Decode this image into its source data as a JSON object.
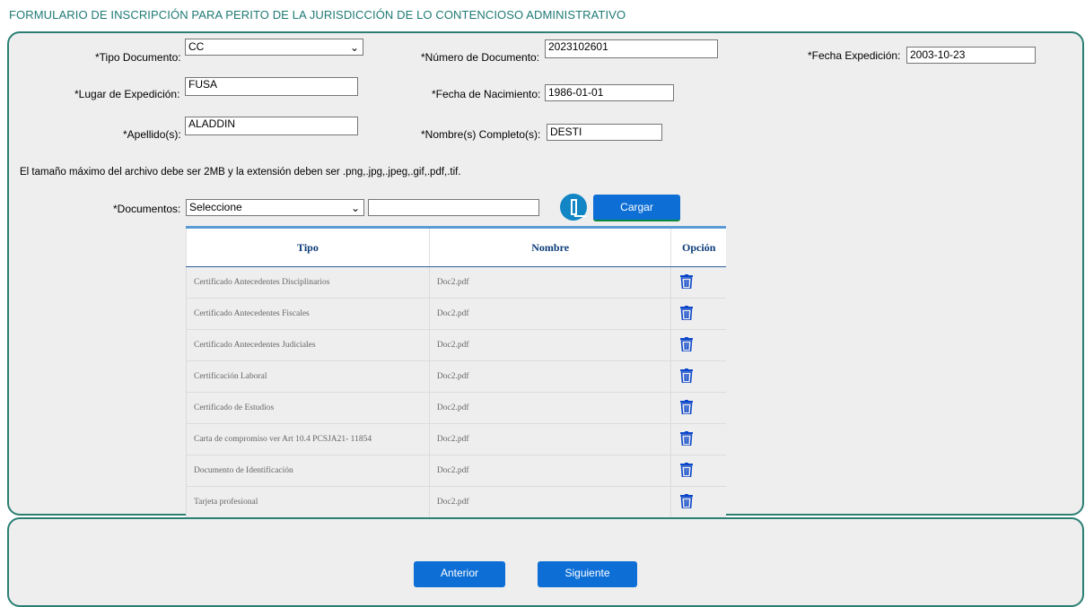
{
  "title": "FORMULARIO DE INSCRIPCIÓN PARA PERITO DE LA JURISDICCIÓN DE LO CONTENCIOSO ADMINISTRATIVO",
  "form": {
    "tipo_documento": {
      "label": "*Tipo Documento:",
      "value": "CC"
    },
    "numero_documento": {
      "label": "*Número de Documento:",
      "value": "2023102601"
    },
    "fecha_expedicion": {
      "label": "*Fecha Expedición:",
      "value": "2003-10-23"
    },
    "lugar_expedicion": {
      "label": "*Lugar de Expedición:",
      "value": "FUSA"
    },
    "fecha_nacimiento": {
      "label": "*Fecha de Nacimiento:",
      "value": "1986-01-01"
    },
    "apellidos": {
      "label": "*Apellido(s):",
      "value": "ALADDIN"
    },
    "nombres": {
      "label": "*Nombre(s) Completo(s):",
      "value": "DESTI"
    }
  },
  "file_note": "El tamaño máximo del archivo debe ser 2MB y la extensión deben ser .png,.jpg,.jpeg,.gif,.pdf,.tif.",
  "documentos": {
    "label": "*Documentos:",
    "selected": "Seleccione",
    "file_value": "",
    "upload_label": "Cargar"
  },
  "table": {
    "headers": [
      "Tipo",
      "Nombre",
      "Opción"
    ],
    "rows": [
      {
        "tipo": "Certificado Antecedentes Disciplinarios",
        "nombre": "Doc2.pdf"
      },
      {
        "tipo": "Certificado Antecedentes Fiscales",
        "nombre": "Doc2.pdf"
      },
      {
        "tipo": "Certificado Antecedentes Judiciales",
        "nombre": "Doc2.pdf"
      },
      {
        "tipo": "Certificación Laboral",
        "nombre": "Doc2.pdf"
      },
      {
        "tipo": "Certificado de Estudios",
        "nombre": "Doc2.pdf"
      },
      {
        "tipo": "Carta de compromiso ver Art 10.4 PCSJA21- 11854",
        "nombre": "Doc2.pdf"
      },
      {
        "tipo": "Documento de Identificación",
        "nombre": "Doc2.pdf"
      },
      {
        "tipo": "Tarjeta profesional",
        "nombre": "Doc2.pdf"
      }
    ],
    "delete_icon": "trash-icon"
  },
  "nav": {
    "previous": "Anterior",
    "next": "Siguiente"
  },
  "colors": {
    "accent": "#2a7f73",
    "button": "#0d6fd6",
    "header_text": "#0c3c7a"
  }
}
